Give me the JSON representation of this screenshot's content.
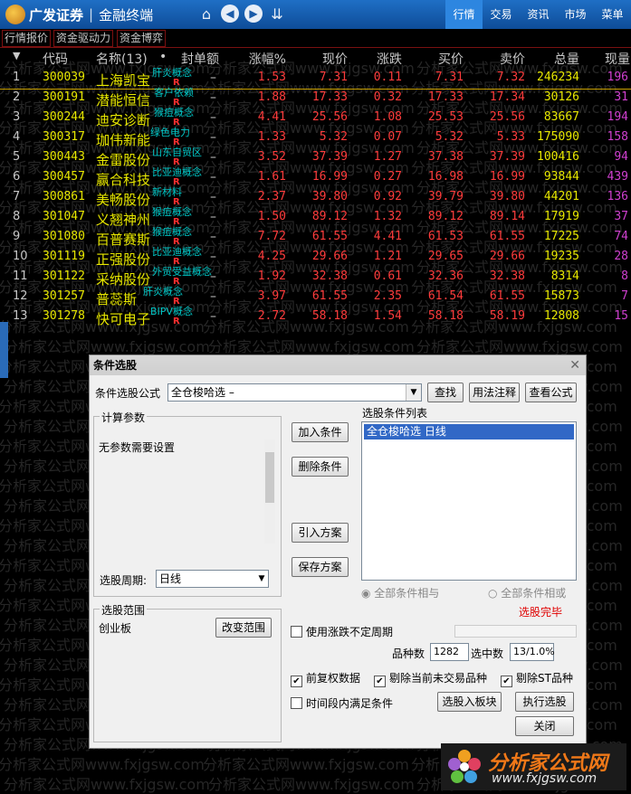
{
  "app": {
    "logo_text": "广发证券",
    "product": "金融终端",
    "top_tabs": [
      "行情",
      "交易",
      "资讯",
      "市场",
      "菜单"
    ]
  },
  "subtabs": [
    "行情报价",
    "资金驱动力",
    "资金博弈"
  ],
  "table": {
    "headers": {
      "code": "代码",
      "name": "名称(13)",
      "dot": "•",
      "seal": "封单额",
      "chg_pct": "涨幅%",
      "price": "现价",
      "diff": "涨跌",
      "buy": "买价",
      "sell": "卖价",
      "volume": "总量",
      "current": "现量"
    },
    "rows": [
      {
        "idx": "1",
        "code": "300039",
        "name": "上海凯宝",
        "tag": "肝炎概念",
        "flag": "R",
        "seal": "–",
        "chg": "1.53",
        "price": "7.31",
        "diff": "0.11",
        "buy": "7.31",
        "sell": "7.32",
        "vol": "246234",
        "cur": "196"
      },
      {
        "idx": "2",
        "code": "300191",
        "name": "潜能恒信",
        "tag": "客户依赖",
        "flag": "R",
        "seal": "–",
        "chg": "1.88",
        "price": "17.33",
        "diff": "0.32",
        "buy": "17.33",
        "sell": "17.34",
        "vol": "30126",
        "cur": "31"
      },
      {
        "idx": "3",
        "code": "300244",
        "name": "迪安诊断",
        "tag": "猴痘概念",
        "flag": "R",
        "seal": "–",
        "chg": "4.41",
        "price": "25.56",
        "diff": "1.08",
        "buy": "25.53",
        "sell": "25.56",
        "vol": "83667",
        "cur": "194"
      },
      {
        "idx": "4",
        "code": "300317",
        "name": "珈伟新能",
        "tag": "绿色电力",
        "flag": "R",
        "seal": "–",
        "chg": "1.33",
        "price": "5.32",
        "diff": "0.07",
        "buy": "5.32",
        "sell": "5.33",
        "vol": "175090",
        "cur": "158"
      },
      {
        "idx": "5",
        "code": "300443",
        "name": "金雷股份",
        "tag": "山东自贸区",
        "flag": "R",
        "seal": "–",
        "chg": "3.52",
        "price": "37.39",
        "diff": "1.27",
        "buy": "37.38",
        "sell": "37.39",
        "vol": "100416",
        "cur": "94"
      },
      {
        "idx": "6",
        "code": "300457",
        "name": "赢合科技",
        "tag": "比亚迪概念",
        "flag": "R",
        "seal": "–",
        "chg": "1.61",
        "price": "16.99",
        "diff": "0.27",
        "buy": "16.98",
        "sell": "16.99",
        "vol": "93844",
        "cur": "439"
      },
      {
        "idx": "7",
        "code": "300861",
        "name": "美畅股份",
        "tag": "新材料",
        "flag": "R",
        "seal": "–",
        "chg": "2.37",
        "price": "39.80",
        "diff": "0.92",
        "buy": "39.79",
        "sell": "39.80",
        "vol": "44201",
        "cur": "136"
      },
      {
        "idx": "8",
        "code": "301047",
        "name": "义翘神州",
        "tag": "猴痘概念",
        "flag": "R",
        "seal": "–",
        "chg": "1.50",
        "price": "89.12",
        "diff": "1.32",
        "buy": "89.12",
        "sell": "89.14",
        "vol": "17919",
        "cur": "37"
      },
      {
        "idx": "9",
        "code": "301080",
        "name": "百普赛斯",
        "tag": "猴痘概念",
        "flag": "R",
        "seal": "–",
        "chg": "7.72",
        "price": "61.55",
        "diff": "4.41",
        "buy": "61.53",
        "sell": "61.55",
        "vol": "17225",
        "cur": "74"
      },
      {
        "idx": "10",
        "code": "301119",
        "name": "正强股份",
        "tag": "比亚迪概念",
        "flag": "R",
        "seal": "–",
        "chg": "4.25",
        "price": "29.66",
        "diff": "1.21",
        "buy": "29.65",
        "sell": "29.66",
        "vol": "19235",
        "cur": "28"
      },
      {
        "idx": "11",
        "code": "301122",
        "name": "采纳股份",
        "tag": "外贸受益概念",
        "flag": "R",
        "seal": "–",
        "chg": "1.92",
        "price": "32.38",
        "diff": "0.61",
        "buy": "32.36",
        "sell": "32.38",
        "vol": "8314",
        "cur": "8"
      },
      {
        "idx": "12",
        "code": "301257",
        "name": "普蕊斯",
        "tag": "肝炎概念",
        "flag": "R",
        "seal": "–",
        "chg": "3.97",
        "price": "61.55",
        "diff": "2.35",
        "buy": "61.54",
        "sell": "61.55",
        "vol": "15873",
        "cur": "7"
      },
      {
        "idx": "13",
        "code": "301278",
        "name": "快可电子",
        "tag": "BIPV概念",
        "flag": "R",
        "seal": "–",
        "chg": "2.72",
        "price": "58.18",
        "diff": "1.54",
        "buy": "58.18",
        "sell": "58.19",
        "vol": "12808",
        "cur": "15"
      }
    ]
  },
  "watermark_text": "分析家公式网www.fxjgsw.com",
  "dialog": {
    "title": "条件选股",
    "formula_label": "条件选股公式",
    "formula_value": "全仓梭哈选 –",
    "find_button": "查找",
    "usage_button": "用法注释",
    "view_button": "查看公式",
    "params_group": "计算参数",
    "params_text": "无参数需要设置",
    "period_label": "选股周期:",
    "period_value": "日线",
    "add_condition": "加入条件",
    "delete_condition": "删除条件",
    "import_plan": "引入方案",
    "save_plan": "保存方案",
    "list_label": "选股条件列表",
    "list_items": [
      "全仓梭哈选  日线"
    ],
    "radio_and": "全部条件相与",
    "radio_or": "全部条件相或",
    "done_text": "选股完毕",
    "range_group": "选股范围",
    "range_value": "创业板",
    "change_range": "改变范围",
    "variable_period": "使用涨跌不定周期",
    "count_label": "品种数",
    "count_value": "1282",
    "selected_label": "选中数",
    "selected_value": "13/1.0%",
    "pre_adjust": "前复权数据",
    "exclude_untraded": "剔除当前未交易品种",
    "exclude_st": "剔除ST品种",
    "time_range": "时间段内满足条件",
    "to_sector": "选股入板块",
    "execute": "执行选股",
    "close": "关闭"
  },
  "brand": {
    "name": "分析家公式网",
    "url": "www.fxjgsw.com"
  },
  "colors": {
    "up_red": "#ff3c3c",
    "code_yellow": "#e8e800",
    "tag_cyan": "#00c8c8",
    "topbar_blue": "#1a5aa8",
    "selection_blue": "#3168c6",
    "brand_orange": "#f07818"
  }
}
